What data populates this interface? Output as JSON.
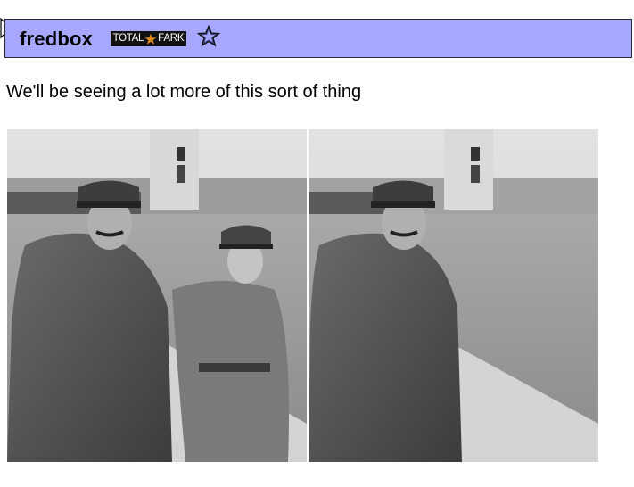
{
  "header": {
    "username": "fredbox",
    "badge": {
      "word1": "TOTAL",
      "word2": "FARK",
      "bg_color": "#111111",
      "star_color": "#e08a1e"
    },
    "favorite_icon": "star-outline-icon",
    "bar_color": "#a6a8ff"
  },
  "post": {
    "text": "We'll be seeing a lot more of this sort of thing"
  },
  "image": {
    "description_icon": "photo-image",
    "panels": [
      "left-photo",
      "right-photo"
    ]
  }
}
